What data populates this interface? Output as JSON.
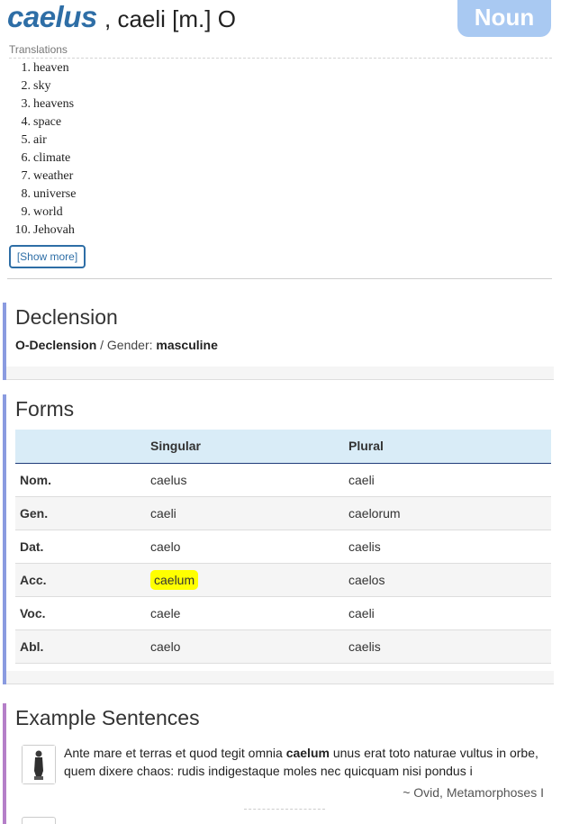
{
  "header": {
    "lemma": "caelus",
    "rest": ", caeli [m.] O",
    "part_of_speech": "Noun"
  },
  "translations": {
    "label": "Translations",
    "items": [
      {
        "num": "1.",
        "text": "heaven"
      },
      {
        "num": "2.",
        "text": "sky"
      },
      {
        "num": "3.",
        "text": "heavens"
      },
      {
        "num": "4.",
        "text": "space"
      },
      {
        "num": "5.",
        "text": "air"
      },
      {
        "num": "6.",
        "text": "climate"
      },
      {
        "num": "7.",
        "text": "weather"
      },
      {
        "num": "8.",
        "text": "universe"
      },
      {
        "num": "9.",
        "text": "world"
      },
      {
        "num": "10.",
        "text": "Jehovah"
      }
    ],
    "show_more": "[Show more]"
  },
  "declension": {
    "title": "Declension",
    "declension_name": "O-Declension",
    "separator": " / Gender: ",
    "gender": "masculine"
  },
  "forms": {
    "title": "Forms",
    "headers": [
      "",
      "Singular",
      "Plural"
    ],
    "rows": [
      {
        "case": "Nom.",
        "singular": "caelus",
        "plural": "caeli"
      },
      {
        "case": "Gen.",
        "singular": "caeli",
        "plural": "caelorum"
      },
      {
        "case": "Dat.",
        "singular": "caelo",
        "plural": "caelis"
      },
      {
        "case": "Acc.",
        "singular": "caelum",
        "plural": "caelos",
        "highlight_singular": true
      },
      {
        "case": "Voc.",
        "singular": "caele",
        "plural": "caeli"
      },
      {
        "case": "Abl.",
        "singular": "caelo",
        "plural": "caelis"
      }
    ]
  },
  "examples": {
    "title": "Example Sentences",
    "items": [
      {
        "text_before": "Ante mare et terras et quod tegit omnia ",
        "keyword": "caelum",
        "text_after": " unus erat toto naturae vultus in orbe, quem dixere chaos: rudis indigestaque moles nec quicquam nisi pondus i",
        "attribution": "~ Ovid, Metamorphoses I"
      }
    ]
  },
  "colors": {
    "lemma": "#2e6ea6",
    "badge": "#a9c9f2",
    "declension_bar": "#8a9be0",
    "forms_bar": "#8a9be0",
    "examples_bar": "#b57fc8",
    "table_header_bg": "#d9ecf7",
    "highlight": "#ffff00"
  },
  "icons": {
    "example_thumbnail": "statue-thumbnail-icon"
  }
}
